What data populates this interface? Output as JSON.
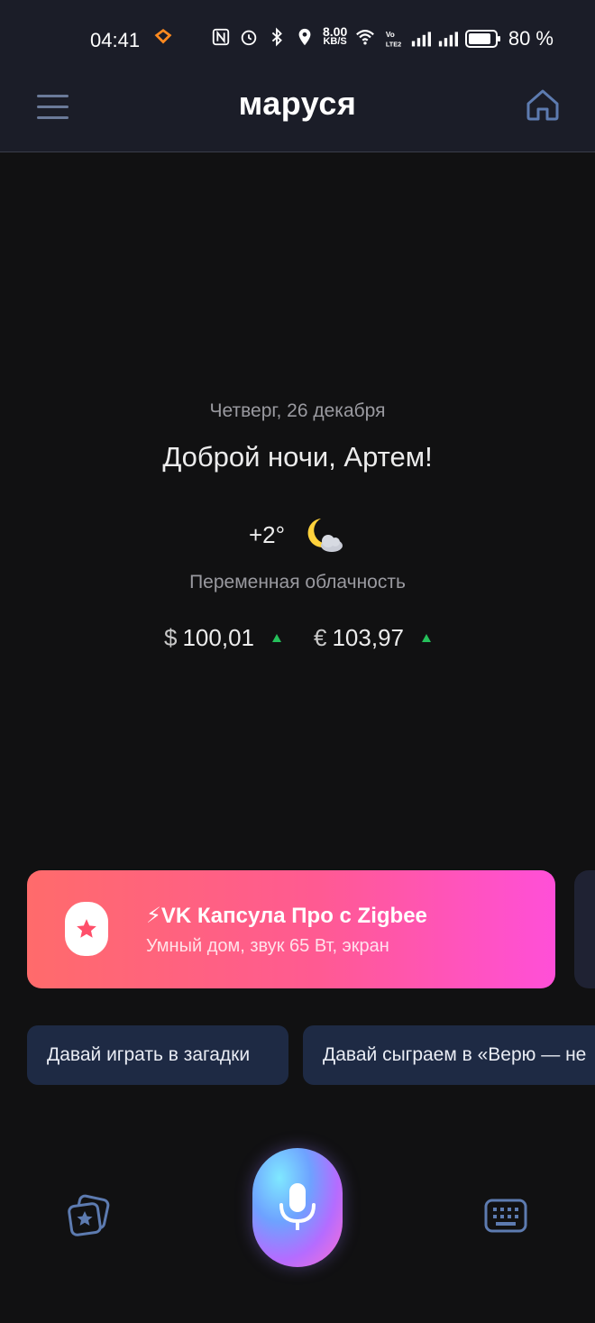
{
  "status_bar": {
    "time": "04:41",
    "net_speed_value": "8.00",
    "net_speed_unit": "KB/S",
    "battery": "80 %",
    "icons": [
      "heart-app-icon",
      "nfc-icon",
      "alarm-icon",
      "bluetooth-icon",
      "location-icon",
      "wifi-icon",
      "volte-icon",
      "signal-icon",
      "signal-icon",
      "battery-icon"
    ]
  },
  "header": {
    "title": "маруся",
    "menu_icon": "hamburger-menu-icon",
    "home_icon": "home-icon"
  },
  "info": {
    "date": "Четверг, 26 декабря",
    "greeting": "Доброй ночи, Артем!",
    "temperature": "+2°",
    "weather_icon": "moon-cloud-icon",
    "weather_desc": "Переменная облачность",
    "currencies": [
      {
        "symbol": "$",
        "value": "100,01",
        "trend": "up"
      },
      {
        "symbol": "€",
        "value": "103,97",
        "trend": "up"
      }
    ]
  },
  "promo": {
    "title": "⚡VK Капсула Про с Zigbee",
    "subtitle": "Умный дом, звук 65 Вт, экран",
    "icon": "star-capsule-icon"
  },
  "chips": [
    {
      "label": "Давай играть в загадки"
    },
    {
      "label": "Давай сыграем в «Верю — не"
    }
  ],
  "bottom_bar": {
    "left_icon": "skills-star-icon",
    "center_icon": "microphone-icon",
    "right_icon": "keyboard-icon"
  },
  "colors": {
    "background": "#111112",
    "header": "#1b1d28",
    "chip": "#1e2a44",
    "promo_start": "#ff6b6b",
    "promo_end": "#ff4fd8",
    "trend_up": "#25c05a"
  }
}
